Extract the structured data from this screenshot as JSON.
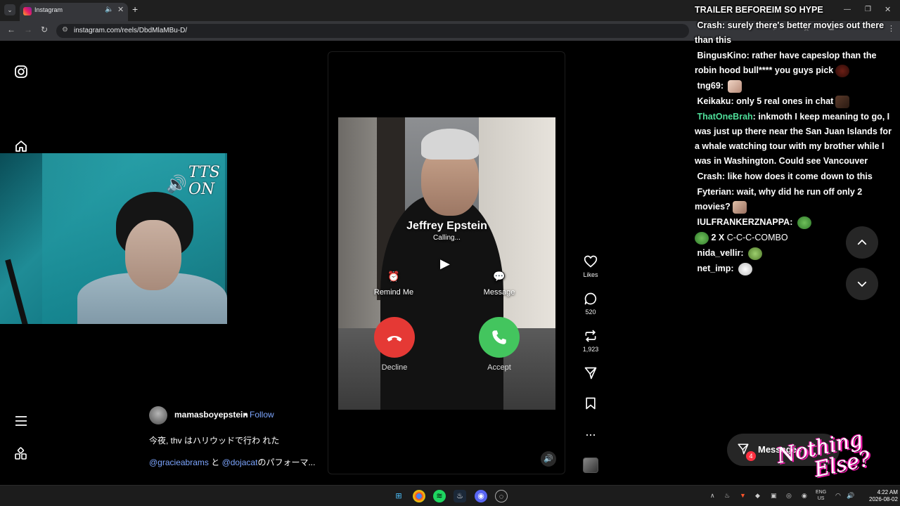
{
  "browser": {
    "tab_title": "Instagram",
    "url": "instagram.com/reels/DbdMlaMBu-D/",
    "new_tab": "+",
    "close": "✕"
  },
  "stream_overlay": {
    "tts_label_line1": "TTS",
    "tts_label_line2": "ON",
    "logo_line1": "Nothing",
    "logo_line2": "Else?"
  },
  "reel": {
    "caller_name": "Jeffrey Epstein",
    "caller_status": "Calling...",
    "remind_label": "Remind Me",
    "message_label": "Message",
    "decline_label": "Decline",
    "accept_label": "Accept"
  },
  "actions": {
    "likes_label": "Likes",
    "comments_count": "520",
    "reposts_count": "1,923",
    "more": "..."
  },
  "post": {
    "author": "mamasboyepstein",
    "separator": "•",
    "follow_label": "Follow",
    "caption_line1": "今夜, thv はハリウッドで行わ れた",
    "mention1": "@gracieabrams",
    "caption_mid": " と ",
    "mention2": "@dojacat",
    "caption_tail": "のパフォーマ..."
  },
  "chat": {
    "header": "TRAILER BEFOREIM SO HYPE",
    "lines": [
      {
        "user": "Crash",
        "text": "surely there's better movies out there than this"
      },
      {
        "user": "BingusKino",
        "text": "rather have capeslop than the robin hood bull**** you guys pick"
      },
      {
        "user": "tng69",
        "text": ""
      },
      {
        "user": "Keikaku",
        "text": "only 5 real ones in chat"
      },
      {
        "user": "ThatOneBrah",
        "text": "inkmoth I keep meaning to go, I was just up there near the San Juan Islands for a whale watching tour with my brother while I was in Washington. Could see Vancouver"
      },
      {
        "user": "Crash",
        "text": "like how does it come down to this"
      },
      {
        "user": "Fyterian",
        "text": "wait, why did he run off only 2 movies?"
      },
      {
        "user": "IULFRANKERZNAPPA",
        "text": ""
      },
      {
        "user": "nida_vellir",
        "text": ""
      },
      {
        "user": "net_imp",
        "text": ""
      }
    ],
    "combo_count": "2",
    "combo_x": "X",
    "combo_text": "C-C-C-COMBO"
  },
  "messages": {
    "label": "Messages",
    "badge": "4"
  },
  "taskbar": {
    "lang_line1": "ENG",
    "lang_line2": "US",
    "time": "4:22 AM",
    "date": "2026-08-02"
  },
  "colors": {
    "decline": "#e53935",
    "accept": "#43c55e",
    "link": "#7da6ff",
    "chat_green": "#4fdf9a",
    "badge": "#ff3040"
  }
}
